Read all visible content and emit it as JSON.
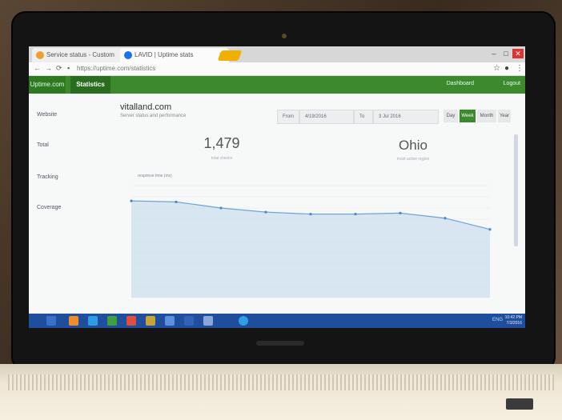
{
  "browser": {
    "tabs": [
      {
        "label": "Service status - Custom",
        "icon_color": "#f0a030"
      },
      {
        "label": "LAVID | Uptime stats",
        "icon_color": "#1a73e8"
      }
    ],
    "url": "https://uptime.com/statistics"
  },
  "app": {
    "nav_home": "Uptime.com",
    "nav_active": "Statistics",
    "header_user_link": "Dashboard",
    "header_logout_link": "Logout"
  },
  "sidebar_labels": {
    "website": "Website",
    "total": "Total",
    "tracking": "Tracking",
    "coverage": "Coverage"
  },
  "site": {
    "name": "vitalland.com",
    "subtitle": "Server status and performance"
  },
  "filters": {
    "from_label": "From",
    "from_value": "4/19/2016",
    "to_label": "To",
    "to_value": "3 Jul 2016",
    "ranges": [
      "Day",
      "Week",
      "Month",
      "Year"
    ],
    "active_range": "Week"
  },
  "stats": {
    "total_value": "1,479",
    "total_caption": "total checks",
    "top_region_value": "Ohio",
    "top_region_caption": "most active region"
  },
  "chart_data": {
    "type": "area",
    "legend": "response time (ms)",
    "color": "#9fc7e8",
    "values": [
      95,
      94,
      88,
      84,
      82,
      82,
      83,
      78,
      67
    ],
    "ylim": [
      0,
      110
    ]
  },
  "taskbar": {
    "tray_text": "ENG",
    "clock_time": "10:42 PM",
    "clock_date": "7/3/2016"
  }
}
